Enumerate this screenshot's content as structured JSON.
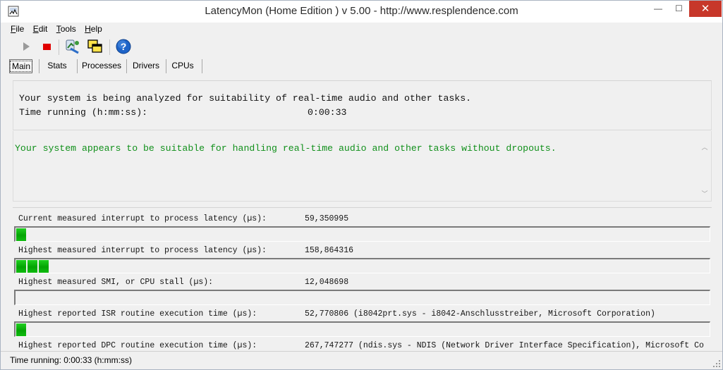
{
  "window": {
    "title": "LatencyMon  (Home Edition )  v 5.00 - http://www.resplendence.com",
    "minimize_glyph": "—",
    "maximize_glyph": "☐",
    "close_glyph": "✕"
  },
  "menu": [
    "File",
    "Edit",
    "Tools",
    "Help"
  ],
  "toolbar": {
    "icons": [
      "play-icon",
      "stop-icon",
      "install-icon",
      "windows-icon",
      "help-icon"
    ],
    "colors": {
      "stop": "#e00000",
      "help": "#1e64c8"
    }
  },
  "tabs": [
    "Main",
    "Stats",
    "Processes",
    "Drivers",
    "CPUs"
  ],
  "analysis": {
    "line1": "Your system is being analyzed for suitability of real-time audio and other tasks.",
    "line2_label": "Time running (h:mm:ss):",
    "line2_value": "0:00:33"
  },
  "verdict": {
    "message": "Your system appears to be suitable for handling real-time audio and other tasks without dropouts.",
    "color": "#11901b"
  },
  "measurements": [
    {
      "label": "Current measured interrupt to process latency (µs):",
      "value": "59,350995",
      "bar_segments": 1
    },
    {
      "label": "Highest measured interrupt to process latency (µs):",
      "value": "158,864316",
      "bar_segments": 3
    },
    {
      "label": "Highest measured SMI, or CPU stall (µs):",
      "value": "12,048698",
      "bar_segments": 0
    },
    {
      "label": "Highest reported ISR routine execution time (µs):",
      "value": "52,770806   (i8042prt.sys - i8042-Anschlusstreiber, Microsoft Corporation)",
      "bar_segments": 1
    },
    {
      "label": "Highest reported DPC routine execution time (µs):",
      "value": "267,747277   (ndis.sys - NDIS (Network Driver Interface Specification), Microsoft Co",
      "bar_segments": 0
    }
  ],
  "status": {
    "text": "Time running: 0:00:33  (h:mm:ss)"
  }
}
